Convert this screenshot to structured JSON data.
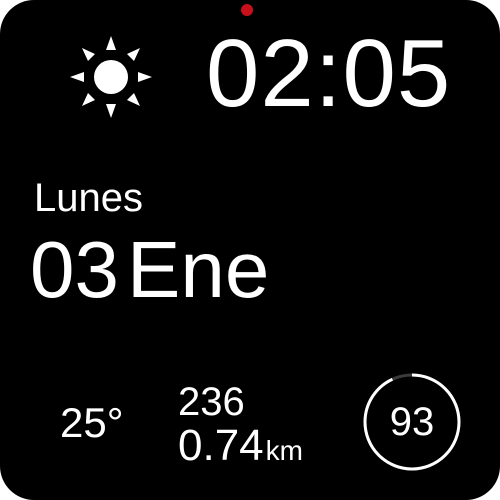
{
  "notification": {
    "color": "#c8101a"
  },
  "weather": {
    "icon": "sun-icon",
    "temperature": "25°"
  },
  "clock": {
    "time": "02:05"
  },
  "date": {
    "weekday": "Lunes",
    "day": "03",
    "month": "Ene"
  },
  "activity": {
    "steps": "236",
    "distance_value": "0.74",
    "distance_unit": "km"
  },
  "battery": {
    "value": "93",
    "level": 0.93
  }
}
